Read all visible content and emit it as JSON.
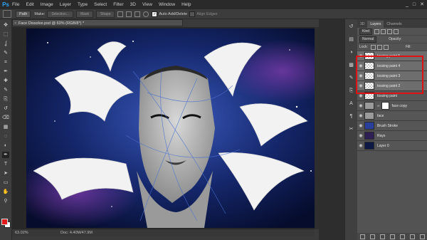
{
  "app": {
    "logo": "Ps"
  },
  "menu": [
    "File",
    "Edit",
    "Image",
    "Layer",
    "Type",
    "Select",
    "Filter",
    "3D",
    "View",
    "Window",
    "Help"
  ],
  "window_controls": [
    "_",
    "□",
    "✕"
  ],
  "options": {
    "path_mode": "Path",
    "make_label": "Make:",
    "selection_btn": "Selection...",
    "mask_btn": "Mask",
    "shape_btn": "Shape",
    "auto_add_delete": "Auto Add/Delete",
    "align_edges": "Align Edges"
  },
  "document": {
    "tab_title": "Face Dissolve.psd @ 63% (RGB/8*) *",
    "close_glyph": "×"
  },
  "status": {
    "zoom": "63.02%",
    "doc": "Doc: 4.40M/47.9M"
  },
  "colors": {
    "foreground": "#e01a1a",
    "background": "#ffffff",
    "highlight": "#e21010"
  },
  "layers_panel": {
    "tabs": [
      "3D",
      "Layers",
      "Channels"
    ],
    "kind_label": "Kind",
    "blend_mode": "Normal",
    "opacity_label": "Opacity:",
    "lock_label": "Lock:",
    "fill_label": "Fill:",
    "layers": [
      {
        "name": "tossing paint 5",
        "thumb": "checker",
        "selected": true
      },
      {
        "name": "tossing paint 4",
        "thumb": "checker",
        "selected": true
      },
      {
        "name": "tossing paint 3",
        "thumb": "checker",
        "selected": true
      },
      {
        "name": "tossing paint 2",
        "thumb": "checker",
        "selected": true
      },
      {
        "name": "tossing paint",
        "thumb": "checker",
        "selected": false
      },
      {
        "name": "face copy",
        "thumb": "face",
        "selected": false,
        "mask": true
      },
      {
        "name": "face",
        "thumb": "face",
        "selected": false
      },
      {
        "name": "Brush Stroke",
        "thumb": "stroke",
        "selected": false
      },
      {
        "name": "Rays",
        "thumb": "rays",
        "selected": false
      },
      {
        "name": "Layer 0",
        "thumb": "space",
        "selected": false
      }
    ]
  },
  "tools": [
    "move-tool",
    "marquee-tool",
    "lasso-tool",
    "quick-select-tool",
    "crop-tool",
    "eyedropper-tool",
    "healing-brush-tool",
    "brush-tool",
    "clone-stamp-tool",
    "history-brush-tool",
    "eraser-tool",
    "gradient-tool",
    "blur-tool",
    "dodge-tool",
    "pen-tool",
    "type-tool",
    "path-select-tool",
    "rectangle-tool",
    "hand-tool",
    "zoom-tool"
  ],
  "tool_glyphs": [
    "✥",
    "⬚",
    "ʆ",
    "✎",
    "⌗",
    "✒",
    "✚",
    "✎",
    "⎘",
    "↺",
    "⌫",
    "▦",
    "◌",
    "◐",
    "✒",
    "T",
    "➤",
    "▭",
    "✋",
    "⚲"
  ],
  "dock_icons": [
    "history-icon",
    "properties-icon",
    "adjustments-icon",
    "styles-icon",
    "brush-icon",
    "clone-source-icon",
    "character-icon",
    "paragraph-icon",
    "tool-presets-icon"
  ],
  "dock_glyphs": [
    "↺",
    "▤",
    "◑",
    "▩",
    "✎",
    "⎘",
    "A",
    "¶",
    "✂"
  ]
}
